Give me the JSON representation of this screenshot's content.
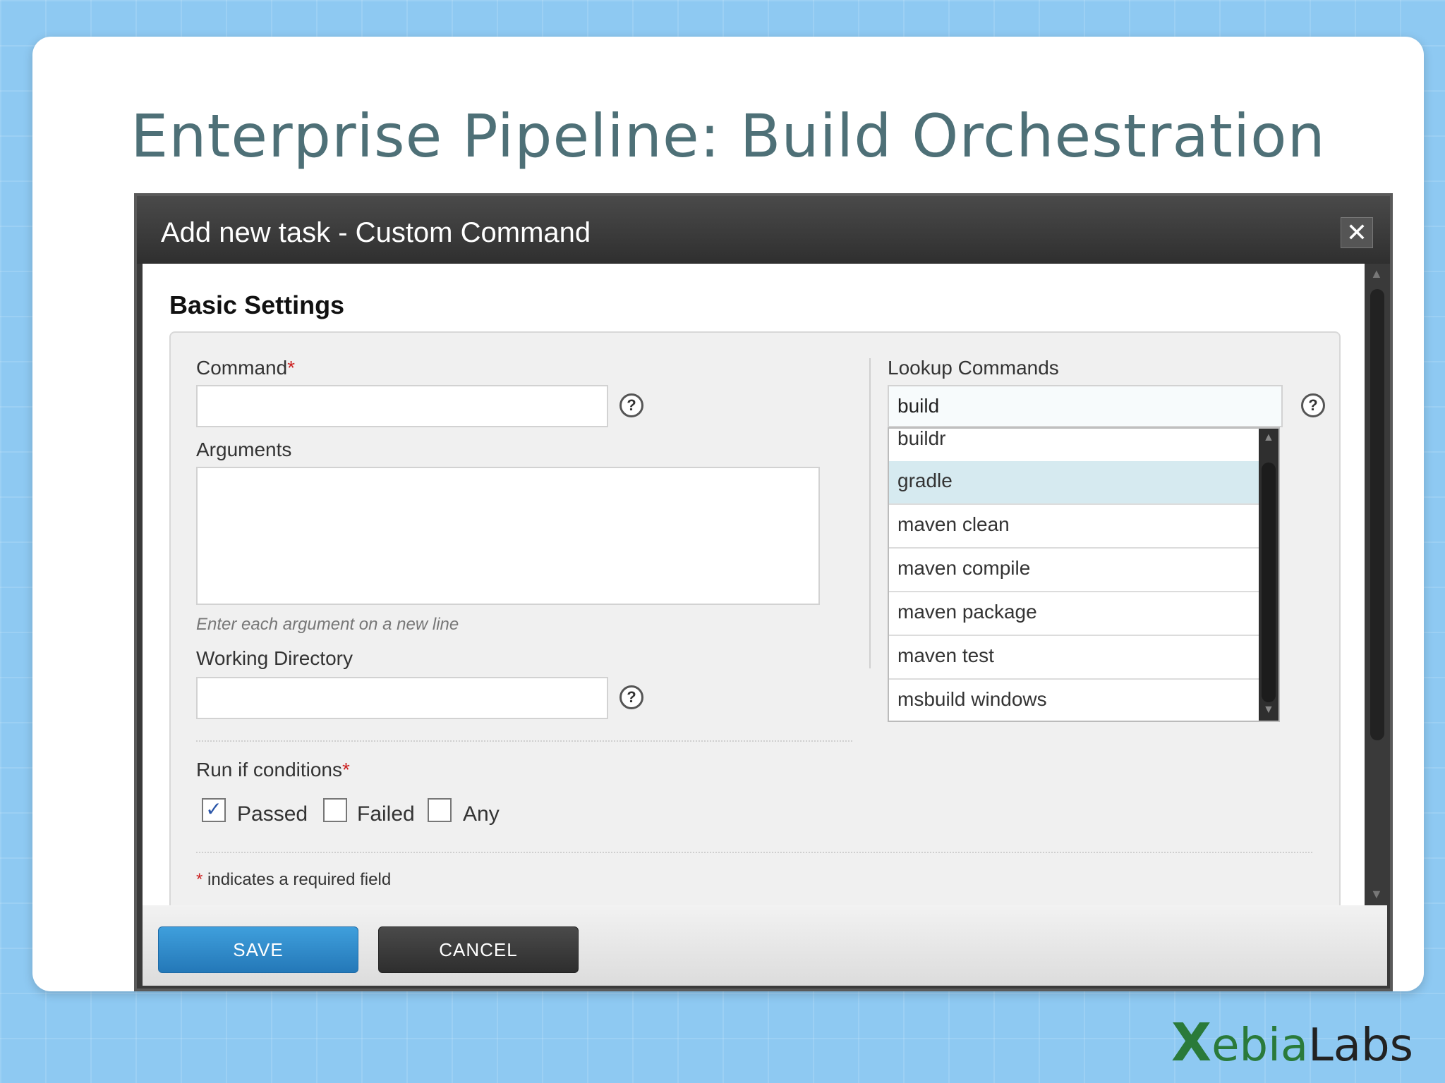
{
  "slide": {
    "title": "Enterprise Pipeline: Build Orchestration"
  },
  "dialog": {
    "title": "Add new task - Custom Command",
    "close_glyph": "✕",
    "section_title": "Basic Settings",
    "command": {
      "label": "Command",
      "required_mark": "*",
      "value": ""
    },
    "arguments": {
      "label": "Arguments",
      "value": "",
      "hint": "Enter each argument on a new line"
    },
    "working_directory": {
      "label": "Working Directory",
      "value": ""
    },
    "help_glyph": "?",
    "lookup": {
      "label": "Lookup Commands",
      "value": "build",
      "options": [
        "buildr",
        "gradle",
        "maven clean",
        "maven compile",
        "maven package",
        "maven test",
        "msbuild windows"
      ],
      "selected": "gradle"
    },
    "run_if": {
      "label": "Run if conditions",
      "required_mark": "*",
      "options": [
        {
          "label": "Passed",
          "checked": true
        },
        {
          "label": "Failed",
          "checked": false
        },
        {
          "label": "Any",
          "checked": false
        }
      ]
    },
    "required_note": {
      "mark": "*",
      "text": " indicates a required field"
    },
    "buttons": {
      "save": "SAVE",
      "cancel": "CANCEL"
    }
  },
  "logo": {
    "x": "X",
    "ebia": "ebia",
    "labs": "Labs"
  },
  "colors": {
    "accent_blue": "#2f8fd0",
    "selected_row": "#d6eaf0",
    "title": "#4e7077",
    "logo_green": "#2a7a3a"
  }
}
